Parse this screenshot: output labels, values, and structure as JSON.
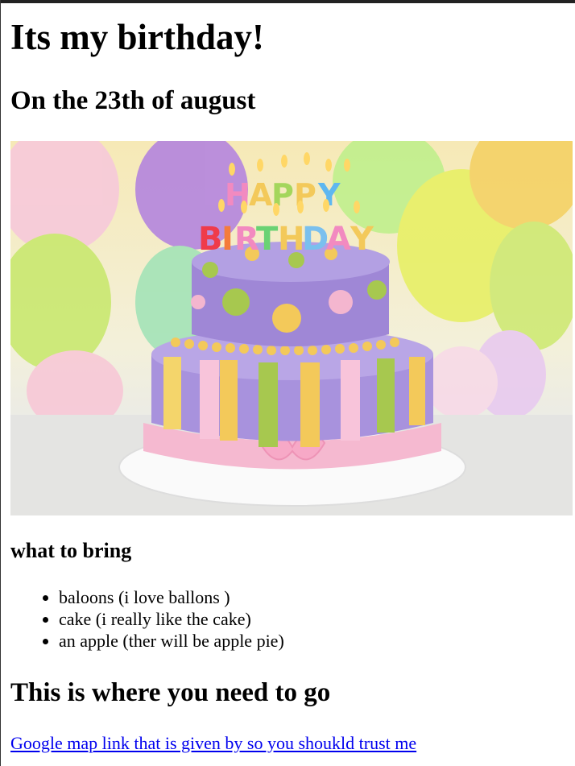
{
  "page": {
    "title": "Its my birthday!",
    "subtitle": "On the 23th of august"
  },
  "hero": {
    "alt_text": "Happy Birthday cake",
    "candle_letters_row1": [
      "H",
      "A",
      "P",
      "P",
      "Y"
    ],
    "candle_letters_row2": [
      "B",
      "I",
      "R",
      "T",
      "H",
      "D",
      "A",
      "Y"
    ]
  },
  "bring": {
    "heading": "what to bring",
    "items": [
      "baloons (i love ballons )",
      "cake (i really like the cake)",
      "an apple (ther will be apple pie)"
    ]
  },
  "directions": {
    "heading": "This is where you need to go",
    "link_text": "Google map link that is given by so you shoukld trust me"
  },
  "colors": {
    "link": "#0000ee",
    "text": "#000000",
    "cake_purple": "#a58fd8",
    "frosting_pink": "#f4b6cf",
    "dot_yellow": "#f3c95a",
    "dot_green": "#a7c84f"
  }
}
